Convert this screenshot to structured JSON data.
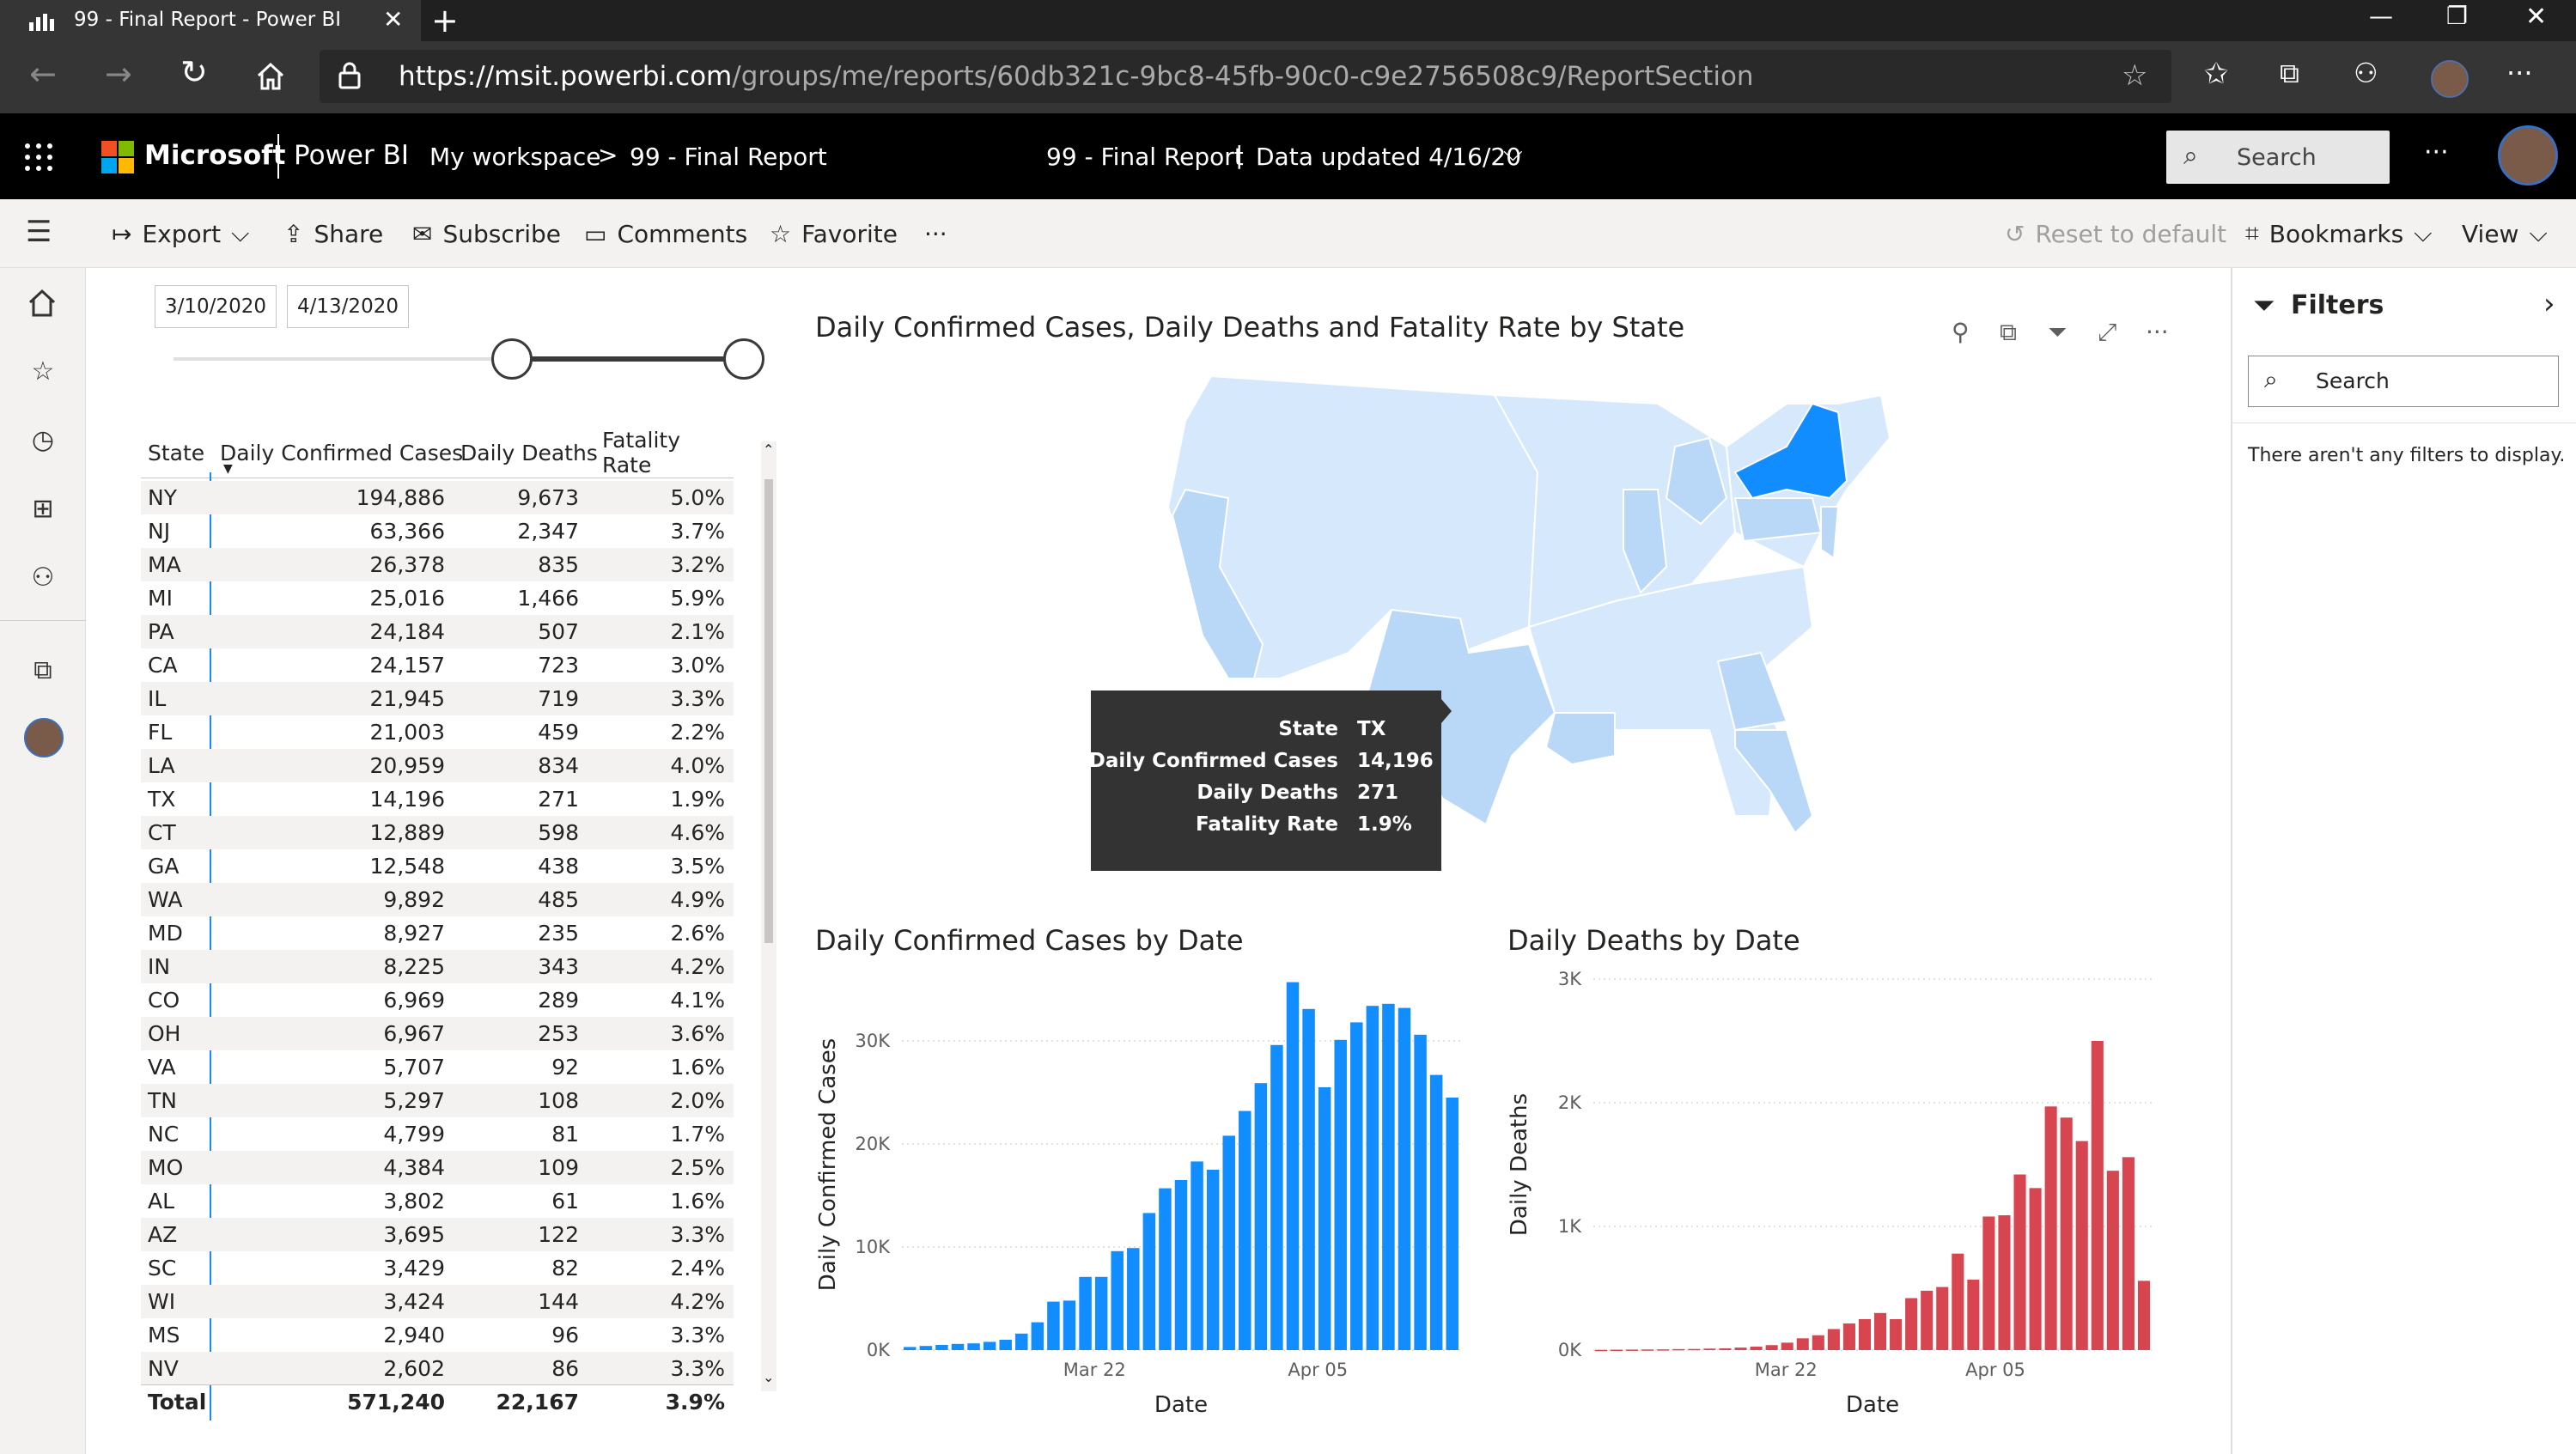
{
  "browser": {
    "tab_title": "99 - Final Report - Power BI",
    "url_host": "https://msit.powerbi.com",
    "url_path": "/groups/me/reports/60db321c-9bc8-45fb-90c0-c9e2756508c9/ReportSection"
  },
  "header": {
    "brand": "Microsoft",
    "product": "Power BI",
    "breadcrumb_workspace": "My workspace",
    "breadcrumb_sep": ">",
    "breadcrumb_report": "99 - Final Report",
    "center_title": "99 - Final Report",
    "center_sep": "|",
    "data_updated": "Data updated 4/16/20",
    "search_placeholder": "Search",
    "more": "···"
  },
  "toolbar": {
    "export": "Export",
    "share": "Share",
    "subscribe": "Subscribe",
    "comments": "Comments",
    "favorite": "Favorite",
    "more": "···",
    "reset": "Reset to default",
    "bookmarks": "Bookmarks",
    "view": "View"
  },
  "slicer": {
    "start": "3/10/2020",
    "end": "4/13/2020"
  },
  "table": {
    "headers": [
      "State",
      "Daily Confirmed Cases",
      "Daily Deaths",
      "Fatality Rate"
    ],
    "rows": [
      [
        "NY",
        "194,886",
        "9,673",
        "5.0%"
      ],
      [
        "NJ",
        "63,366",
        "2,347",
        "3.7%"
      ],
      [
        "MA",
        "26,378",
        "835",
        "3.2%"
      ],
      [
        "MI",
        "25,016",
        "1,466",
        "5.9%"
      ],
      [
        "PA",
        "24,184",
        "507",
        "2.1%"
      ],
      [
        "CA",
        "24,157",
        "723",
        "3.0%"
      ],
      [
        "IL",
        "21,945",
        "719",
        "3.3%"
      ],
      [
        "FL",
        "21,003",
        "459",
        "2.2%"
      ],
      [
        "LA",
        "20,959",
        "834",
        "4.0%"
      ],
      [
        "TX",
        "14,196",
        "271",
        "1.9%"
      ],
      [
        "CT",
        "12,889",
        "598",
        "4.6%"
      ],
      [
        "GA",
        "12,548",
        "438",
        "3.5%"
      ],
      [
        "WA",
        "9,892",
        "485",
        "4.9%"
      ],
      [
        "MD",
        "8,927",
        "235",
        "2.6%"
      ],
      [
        "IN",
        "8,225",
        "343",
        "4.2%"
      ],
      [
        "CO",
        "6,969",
        "289",
        "4.1%"
      ],
      [
        "OH",
        "6,967",
        "253",
        "3.6%"
      ],
      [
        "VA",
        "5,707",
        "92",
        "1.6%"
      ],
      [
        "TN",
        "5,297",
        "108",
        "2.0%"
      ],
      [
        "NC",
        "4,799",
        "81",
        "1.7%"
      ],
      [
        "MO",
        "4,384",
        "109",
        "2.5%"
      ],
      [
        "AL",
        "3,802",
        "61",
        "1.6%"
      ],
      [
        "AZ",
        "3,695",
        "122",
        "3.3%"
      ],
      [
        "SC",
        "3,429",
        "82",
        "2.4%"
      ],
      [
        "WI",
        "3,424",
        "144",
        "4.2%"
      ],
      [
        "MS",
        "2,940",
        "96",
        "3.3%"
      ],
      [
        "NV",
        "2,602",
        "86",
        "3.3%"
      ]
    ],
    "total": [
      "Total",
      "571,240",
      "22,167",
      "3.9%"
    ]
  },
  "map": {
    "title": "Daily Confirmed Cases, Daily Deaths and Fatality Rate by State",
    "tooltip": {
      "labels": [
        "State",
        "Daily Confirmed Cases",
        "Daily Deaths",
        "Fatality Rate"
      ],
      "values": [
        "TX",
        "14,196",
        "271",
        "1.9%"
      ]
    },
    "colors": {
      "light": "#d6e8fb",
      "mid": "#b9d8f7",
      "dark": "#118dff"
    }
  },
  "filters": {
    "title": "Filters",
    "search": "Search",
    "empty": "There aren't any filters to display."
  },
  "chart_data": [
    {
      "type": "bar",
      "title": "Daily Confirmed Cases by Date",
      "xlabel": "Date",
      "ylabel": "Daily Confirmed Cases",
      "x_ticks": [
        "Mar 22",
        "Apr 05"
      ],
      "y_ticks": [
        "0K",
        "10K",
        "20K",
        "30K"
      ],
      "ylim": [
        0,
        36000
      ],
      "color": "#118dff",
      "values": [
        300,
        400,
        500,
        600,
        650,
        800,
        1000,
        1600,
        2700,
        4700,
        4800,
        7100,
        7100,
        9600,
        9900,
        13300,
        15700,
        16500,
        18300,
        17500,
        20800,
        23200,
        25900,
        29600,
        35700,
        33100,
        25500,
        30100,
        31800,
        33400,
        33600,
        33200,
        30600,
        26700,
        24500
      ]
    },
    {
      "type": "bar",
      "title": "Daily Deaths by Date",
      "xlabel": "Date",
      "ylabel": "Daily Deaths",
      "x_ticks": [
        "Mar 22",
        "Apr 05"
      ],
      "y_ticks": [
        "0K",
        "1K",
        "2K",
        "3K"
      ],
      "ylim": [
        0,
        3000
      ],
      "color": "#d64550",
      "values": [
        2,
        3,
        4,
        5,
        6,
        8,
        9,
        12,
        14,
        20,
        28,
        40,
        60,
        95,
        120,
        170,
        215,
        250,
        300,
        250,
        420,
        480,
        510,
        780,
        570,
        1080,
        1090,
        1420,
        1310,
        1970,
        1880,
        1690,
        2500,
        1450,
        1560,
        560
      ]
    }
  ]
}
